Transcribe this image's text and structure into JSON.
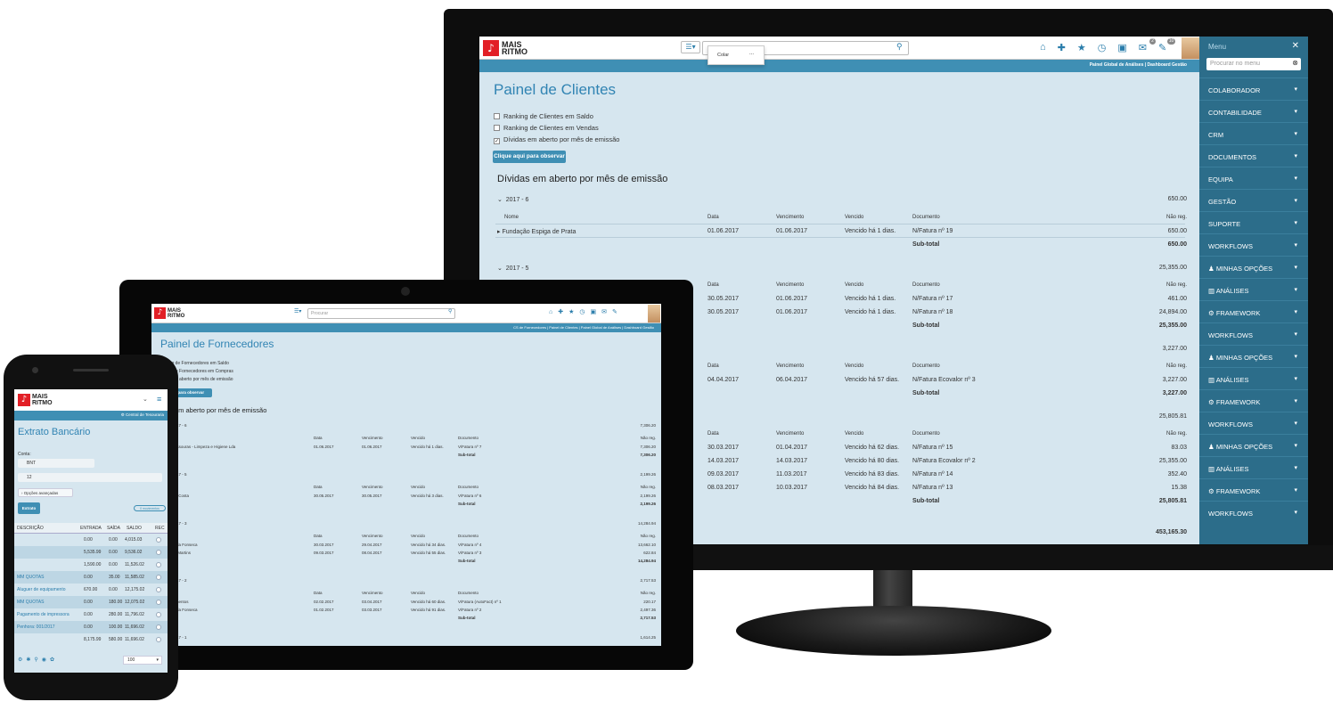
{
  "brand": {
    "logo_line1": "MAIS",
    "logo_line2": "RITMO",
    "accent": "#3f8fb4",
    "logo_color": "#e21f26"
  },
  "monitor": {
    "paste_menu": {
      "colar": "Colar",
      "dots": "..."
    },
    "breadcrumb": "Painel Global de Análises | Dashboard Gestão",
    "page_title": "Painel de Clientes",
    "options": [
      {
        "label": "Ranking de Clientes em Saldo",
        "checked": false
      },
      {
        "label": "Ranking de Clientes em Vendas",
        "checked": false
      },
      {
        "label": "Dívidas em aberto por mês de emissão",
        "checked": true
      }
    ],
    "observe_button": "Clique aqui para observar",
    "section_title": "Dívidas em aberto por mês de emissão",
    "columns": {
      "name": "Nome",
      "data": "Data",
      "vencimento": "Vencimento",
      "vencido": "Vencido",
      "documento": "Documento",
      "naoreg": "Não reg."
    },
    "groups": [
      {
        "label": "2017 - 6",
        "total": "650.00",
        "rows": [
          {
            "name": "Fundação Espiga de Prata",
            "data": "01.06.2017",
            "venc": "01.06.2017",
            "vencido": "Vencido há 1 dias.",
            "doc": "N/Fatura nº 19",
            "val": "650.00"
          }
        ],
        "subtotal": "650.00"
      },
      {
        "label": "2017 - 5",
        "total": "25,355.00",
        "rows": [
          {
            "data": "30.05.2017",
            "venc": "01.06.2017",
            "vencido": "Vencido há 1 dias.",
            "doc": "N/Fatura nº 17",
            "val": "461.00"
          },
          {
            "data": "30.05.2017",
            "venc": "01.06.2017",
            "vencido": "Vencido há 1 dias.",
            "doc": "N/Fatura nº 18",
            "val": "24,894.00"
          }
        ],
        "subtotal": "25,355.00"
      },
      {
        "total": "3,227.00",
        "rows": [
          {
            "data": "04.04.2017",
            "venc": "06.04.2017",
            "vencido": "Vencido há 57 dias.",
            "doc": "N/Fatura Ecovalor nº 3",
            "val": "3,227.00"
          }
        ],
        "subtotal": "3,227.00"
      },
      {
        "total": "25,805.81",
        "rows": [
          {
            "data": "30.03.2017",
            "venc": "01.04.2017",
            "vencido": "Vencido há 62 dias.",
            "doc": "N/Fatura nº 15",
            "val": "83.03"
          },
          {
            "data": "14.03.2017",
            "venc": "14.03.2017",
            "vencido": "Vencido há 80 dias.",
            "doc": "N/Fatura Ecovalor nº 2",
            "val": "25,355.00"
          },
          {
            "data": "09.03.2017",
            "venc": "11.03.2017",
            "vencido": "Vencido há 83 dias.",
            "doc": "N/Fatura nº 14",
            "val": "352.40"
          },
          {
            "data": "08.03.2017",
            "venc": "10.03.2017",
            "vencido": "Vencido há 84 dias.",
            "doc": "N/Fatura nº 13",
            "val": "15.38"
          }
        ],
        "subtotal": "25,805.81"
      }
    ],
    "subtotal_label": "Sub-total",
    "grand_total": "453,165.30",
    "badges": {
      "mail": "2",
      "chat": "10"
    },
    "sidebar": {
      "title": "Menu",
      "search_placeholder": "Procurar no menu",
      "items": [
        "COLABORADOR",
        "CONTABILIDADE",
        "CRM",
        "DOCUMENTOS",
        "EQUIPA",
        "GESTÃO",
        "SUPORTE",
        "WORKFLOWS",
        "MINHAS OPÇÕES",
        "ANÁLISES",
        "FRAMEWORK",
        "WORKFLOWS",
        "MINHAS OPÇÕES",
        "ANÁLISES",
        "FRAMEWORK",
        "WORKFLOWS",
        "MINHAS OPÇÕES",
        "ANÁLISES",
        "FRAMEWORK",
        "WORKFLOWS"
      ]
    }
  },
  "tablet": {
    "search_placeholder": "Procurar",
    "breadcrumb": "CS de Fornecedores | Painel de Clientes | Painel Global de Análises | Dashboard Gestão",
    "page_title": "Painel de Fornecedores",
    "options": [
      "king de Fornecedores em Saldo",
      "ing de Fornecedores em Compras",
      "as em aberto por mês de emissão"
    ],
    "observe_button": "aqui para observar",
    "section_title": "as em aberto por mês de emissão",
    "cols": {
      "data": "Data",
      "venc": "Vencimento",
      "vencido": "Vencido",
      "doc": "Documento",
      "naoreg": "Não reg."
    },
    "subtotal_label": "Sub-total",
    "groups": [
      {
        "label": "17 - 6",
        "total": "7,306.20",
        "rows": [
          {
            "name": "ra Vassouras - Limpeza e Higiene Lda",
            "data": "01.06.2017",
            "venc": "01.06.2017",
            "vencido": "Vencido há 1 dias.",
            "doc": "V/Fatura nº 7",
            "val": "7,306.20"
          }
        ],
        "subtotal": "7,306.20"
      },
      {
        "label": "17 - 5",
        "total": "2,199.26",
        "rows": [
          {
            "name": "anuel Costa",
            "data": "30.05.2017",
            "venc": "30.05.2017",
            "vencido": "Vencido há 3 dias.",
            "doc": "V/Fatura nº 6",
            "val": "2,199.26"
          }
        ],
        "subtotal": "2,199.26"
      },
      {
        "label": "17 - 3",
        "total": "14,284.94",
        "rows": [
          {
            "name": "beta da Fonseca",
            "data": "30.03.2017",
            "venc": "29.04.2017",
            "vencido": "Vencido há 34 dias.",
            "doc": "V/Fatura nº 4",
            "val": "13,662.10"
          },
          {
            "name": "ando Martins",
            "data": "09.03.2017",
            "venc": "08.04.2017",
            "vencido": "Vencido há 55 dias.",
            "doc": "V/Fatura nº 3",
            "val": "622.84"
          }
        ],
        "subtotal": "14,284.94"
      },
      {
        "label": "17 - 2",
        "total": "2,717.53",
        "rows": [
          {
            "name": "entamentos",
            "data": "02.02.2017",
            "venc": "03.04.2017",
            "vencido": "Vencido há 60 dias.",
            "doc": "V/Fatura (AutoFact) nº 1",
            "val": "220.17"
          },
          {
            "name": "beta da Fonseca",
            "data": "01.02.2017",
            "venc": "03.03.2017",
            "vencido": "Vencido há 91 dias.",
            "doc": "V/Fatura nº 2",
            "val": "2,497.36"
          }
        ],
        "subtotal": "2,717.53"
      },
      {
        "label": "17 - 1",
        "total": "1,614.25",
        "rows": [],
        "subtotal": ""
      }
    ]
  },
  "phone": {
    "breadcrumb": "Central de Tesouraria",
    "page_title": "Extrato Bancário",
    "conta_label": "Conta:",
    "conta_value": "BNT",
    "num_value": "12",
    "advanced": "Opções avançadas",
    "extrato_button": "Extrato",
    "badge": "0 movimentos",
    "columns": [
      "DESCRIÇÃO",
      "ENTRADA",
      "SAÍDA",
      "SALDO",
      "REC"
    ],
    "rows": [
      {
        "desc": "",
        "entrada": "0.00",
        "saida": "0.00",
        "saldo": "4,015.03"
      },
      {
        "desc": "",
        "entrada": "5,535.99",
        "saida": "0.00",
        "saldo": "9,536.02"
      },
      {
        "desc": "",
        "entrada": "1,590.00",
        "saida": "0.00",
        "saldo": "11,526.02"
      },
      {
        "desc": "MM QUOTAS",
        "entrada": "0.00",
        "saida": "35.00",
        "saldo": "11,585.02"
      },
      {
        "desc": "Aluguer de equipamento",
        "entrada": "670.00",
        "saida": "0.00",
        "saldo": "12,175.02"
      },
      {
        "desc": "MM QUOTAS",
        "entrada": "0.00",
        "saida": "180.00",
        "saldo": "12,075.02"
      },
      {
        "desc": "Pagamento de impressora",
        "entrada": "0.00",
        "saida": "280.00",
        "saldo": "11,796.02"
      },
      {
        "desc": "Penhora: 001/2017",
        "entrada": "0.00",
        "saida": "100.00",
        "saldo": "11,696.02"
      },
      {
        "desc": "",
        "entrada": "8,175.99",
        "saida": "580.00",
        "saldo": "11,696.02"
      }
    ],
    "page_size": "100"
  }
}
